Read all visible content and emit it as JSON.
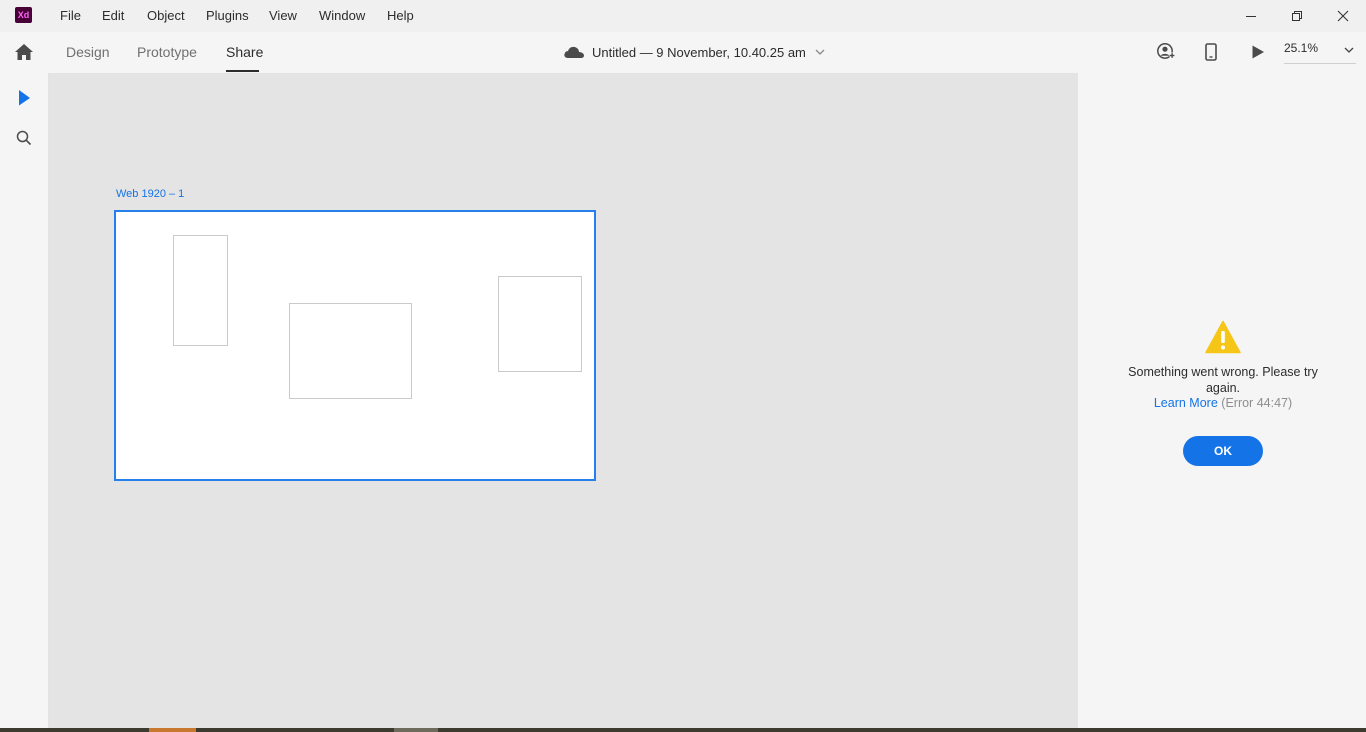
{
  "app": {
    "logo_text": "Xd",
    "logo_bg": "#470137",
    "logo_fg": "#ff61f6"
  },
  "menu": [
    "File",
    "Edit",
    "Object",
    "Plugins",
    "View",
    "Window",
    "Help"
  ],
  "window_controls": {
    "minimize": "minimize-icon",
    "restore": "restore-icon",
    "close": "close-icon"
  },
  "toolbar": {
    "home_icon": "home-icon",
    "tabs": [
      {
        "label": "Design",
        "active": false
      },
      {
        "label": "Prototype",
        "active": false
      },
      {
        "label": "Share",
        "active": true
      }
    ],
    "doc_title": "Untitled — 9 November, 10.40.25 am",
    "cloud_icon": "cloud-icon",
    "invite_icon": "invite-user-icon",
    "device_icon": "mobile-preview-icon",
    "play_icon": "play-icon",
    "zoom": "25.1%"
  },
  "left_tools": [
    "select-arrow-icon",
    "search-icon"
  ],
  "canvas": {
    "artboard_label": "Web 1920 – 1",
    "accent": "#1473e6"
  },
  "right_panel": {
    "warning_icon": "warning-icon",
    "warning_color": "#f5c518",
    "error_message": "Something went wrong. Please try again.",
    "learn_more": "Learn More",
    "error_code": "(Error 44:47)",
    "ok_label": "OK"
  }
}
